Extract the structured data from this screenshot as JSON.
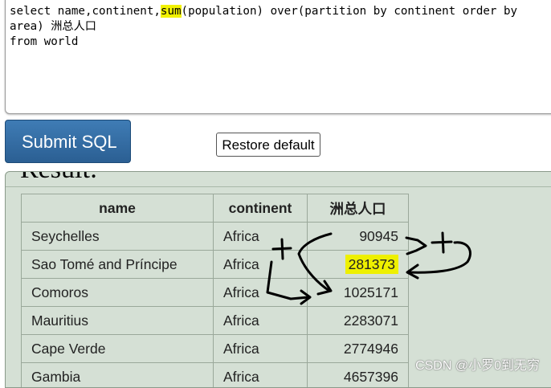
{
  "editor": {
    "line1_a": "select name,continent,",
    "line1_hl": "sum",
    "line1_b": "(population) over(partition by continent order by area) 洲总人口",
    "line2": "from world"
  },
  "buttons": {
    "submit_label": "Submit SQL",
    "restore_label": "Restore default"
  },
  "result": {
    "heading": "Result:",
    "columns": [
      "name",
      "continent",
      "洲总人口"
    ],
    "rows": [
      [
        "Seychelles",
        "Africa",
        "90945"
      ],
      [
        "Sao Tomé and Príncipe",
        "Africa",
        "281373"
      ],
      [
        "Comoros",
        "Africa",
        "1025171"
      ],
      [
        "Mauritius",
        "Africa",
        "2283071"
      ],
      [
        "Cape Verde",
        "Africa",
        "2774946"
      ],
      [
        "Gambia",
        "Africa",
        "4657396"
      ]
    ]
  },
  "colors": {
    "highlight": "#f2f200",
    "submit_button": "#2f6aa0",
    "result_background": "#d5e0d5"
  },
  "watermark": "CSDN @小罗0到无穷"
}
